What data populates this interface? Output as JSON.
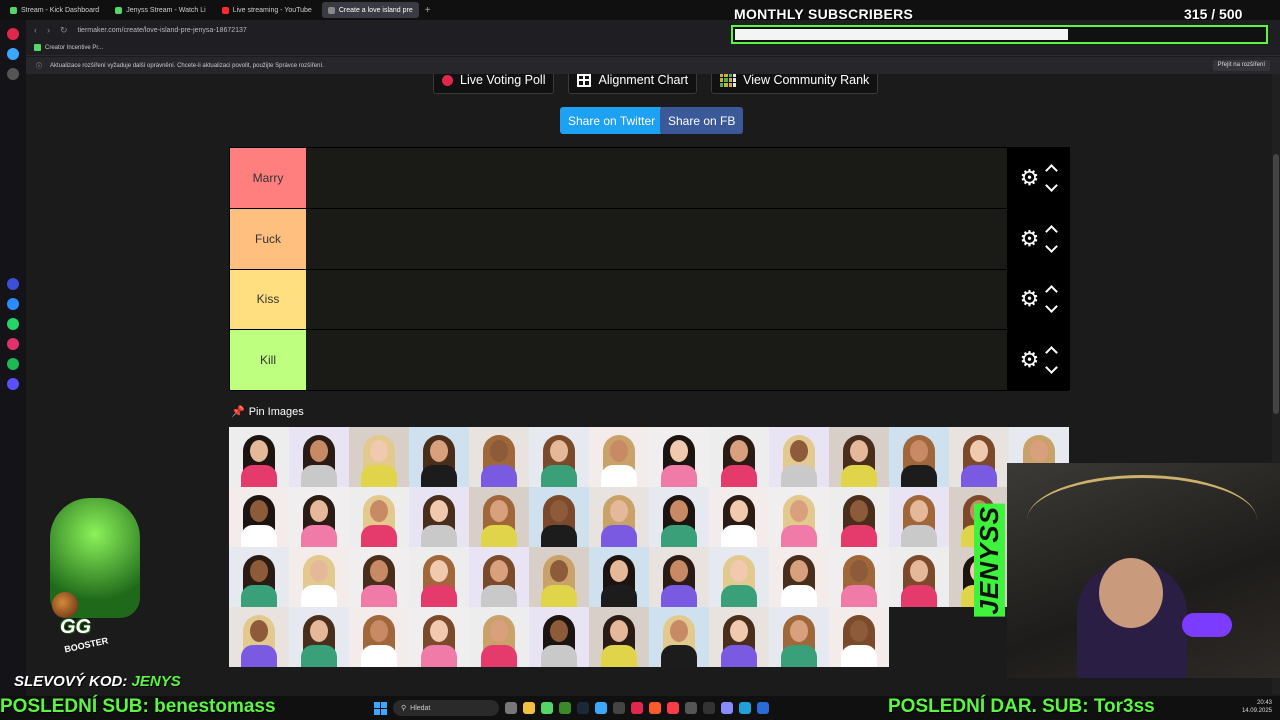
{
  "browser": {
    "tabs": [
      {
        "label": "Stream - Kick Dashboard",
        "color": "#53d769"
      },
      {
        "label": "Jenyss Stream - Watch Li",
        "color": "#53d769"
      },
      {
        "label": "Live streaming - YouTube",
        "color": "#ff2a2a"
      },
      {
        "label": "Create a love island pre",
        "color": "#888888"
      }
    ],
    "new_tab": "+",
    "url": "tiermaker.com/create/love-island-pre-jenysa-18672137",
    "bookmark": "Creator Incentive Pr...",
    "notice": "Aktualizace rozšíření vyžaduje další oprávnění. Chcete-li aktualizaci povolit, použijte Správce rozšíření.",
    "notice_button": "Přejít na rozšíření"
  },
  "overlay": {
    "subs_title": "MONTHLY SUBSCRIBERS",
    "subs_count": "315 / 500",
    "subs_progress": 0.63,
    "code_label": "SLEVOVÝ KOD:",
    "code_value": "JENYS",
    "last_sub": "POSLEDNÍ SUB: benestomass",
    "last_gift": "POSLEDNÍ DAR. SUB: Tor3ss",
    "mascot_text": "GG",
    "mascot_sub": "BOOSTER",
    "side_logo": "JENYSS"
  },
  "page": {
    "buttons": {
      "live_voting": "Live Voting Poll",
      "alignment": "Alignment Chart",
      "community": "View Community Rank",
      "share_twitter": "Share on Twitter",
      "share_fb": "Share on FB"
    },
    "tiers": [
      {
        "label": "Marry",
        "color": "#ff7f7f"
      },
      {
        "label": "Fuck",
        "color": "#ffbf7f"
      },
      {
        "label": "Kiss",
        "color": "#ffdf7f"
      },
      {
        "label": "Kill",
        "color": "#bfff7f"
      }
    ],
    "pin_label": "Pin Images",
    "pool_count": 56
  },
  "taskbar": {
    "search": "Hledat",
    "time": "20:43",
    "date": "14.09.2025"
  },
  "colors": {
    "accent_green": "#5cf542",
    "twitter": "#1da1f2",
    "facebook": "#3b5998"
  }
}
